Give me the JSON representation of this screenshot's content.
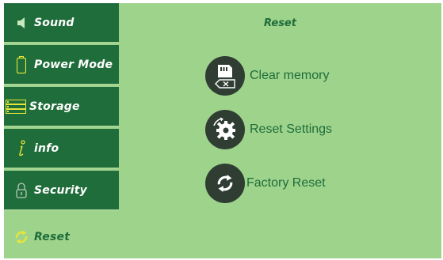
{
  "sidebar": {
    "items": [
      {
        "label": "Sound",
        "icon": "speaker-icon"
      },
      {
        "label": "Power Mode",
        "icon": "battery-icon"
      },
      {
        "label": "Storage",
        "icon": "storage-icon"
      },
      {
        "label": "info",
        "icon": "info-icon"
      },
      {
        "label": "Security",
        "icon": "lock-icon"
      },
      {
        "label": "Reset",
        "icon": "refresh-icon",
        "active": true
      }
    ]
  },
  "main": {
    "title": "Reset",
    "actions": [
      {
        "label": "Clear memory",
        "icon": "sd-card-clear-icon"
      },
      {
        "label": "Reset Settings",
        "icon": "gear-reset-icon"
      },
      {
        "label": "Factory Reset",
        "icon": "refresh-icon"
      }
    ]
  },
  "colors": {
    "sidebar_bg": "#1f6d3a",
    "content_bg": "#9ed38c",
    "accent_text": "#1f6d3a",
    "icon_circle": "#2f3d33",
    "icon_highlight": "#e6e63a"
  }
}
